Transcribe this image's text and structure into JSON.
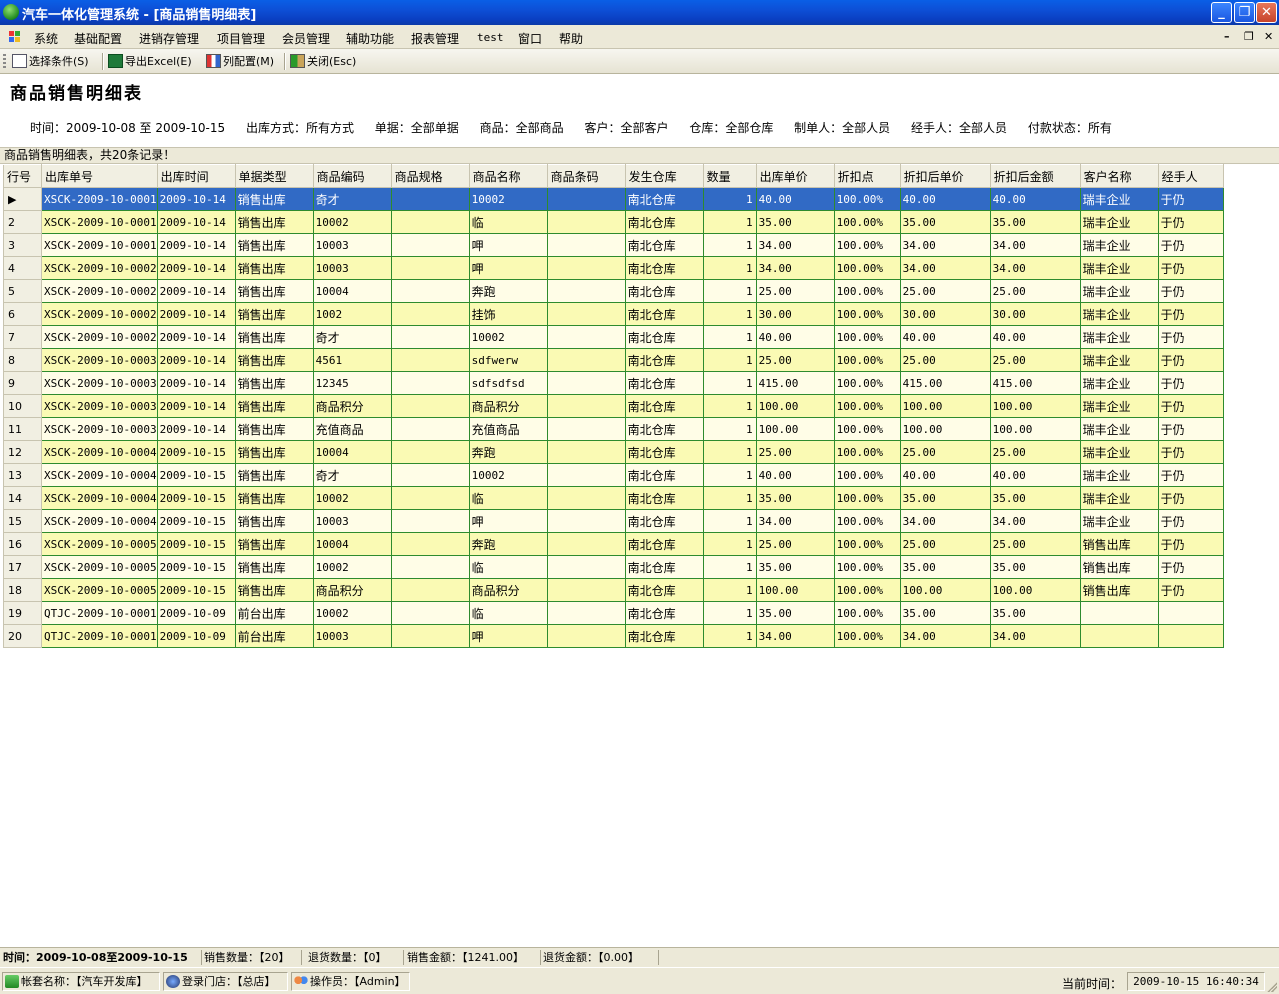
{
  "window": {
    "title": "汽车一体化管理系统 - [商品销售明细表]",
    "minimize": "_",
    "restore": "❐",
    "close": "✕"
  },
  "menu": {
    "items": [
      "系统",
      "基础配置",
      "进销存管理",
      "项目管理",
      "会员管理",
      "辅助功能",
      "报表管理",
      "test",
      "窗口",
      "帮助"
    ],
    "mdi_minimize": "–",
    "mdi_restore": "❐",
    "mdi_close": "✕"
  },
  "toolbar": {
    "select_condition": "选择条件(S)",
    "export_excel": "导出Excel(E)",
    "column_config": "列配置(M)",
    "close": "关闭(Esc)"
  },
  "report": {
    "title": "商品销售明细表",
    "filters": {
      "time": "时间：2009-10-08 至 2009-10-15",
      "out_method": "出库方式：所有方式",
      "doc": "单据：全部单据",
      "product": "商品：全部商品",
      "customer": "客户：全部客户",
      "warehouse": "仓库：全部仓库",
      "creator": "制单人：全部人员",
      "handler": "经手人：全部人员",
      "pay_status": "付款状态：所有"
    },
    "summary": "商品销售明细表，共20条记录！"
  },
  "grid": {
    "headers": [
      "行号",
      "出库单号",
      "出库时间",
      "单据类型",
      "商品编码",
      "商品规格",
      "商品名称",
      "商品条码",
      "发生仓库",
      "数量",
      "出库单价",
      "折扣点",
      "折扣后单价",
      "折扣后金额",
      "客户名称",
      "经手人"
    ],
    "selected_row": 0,
    "rows": [
      [
        "▶",
        "XSCK-2009-10-0001",
        "2009-10-14",
        "销售出库",
        "奇才",
        "",
        "10002",
        "",
        "南北仓库",
        "1",
        "40.00",
        "100.00%",
        "40.00",
        "40.00",
        "瑞丰企业",
        "于仍"
      ],
      [
        "2",
        "XSCK-2009-10-0001",
        "2009-10-14",
        "销售出库",
        "10002",
        "",
        "临",
        "",
        "南北仓库",
        "1",
        "35.00",
        "100.00%",
        "35.00",
        "35.00",
        "瑞丰企业",
        "于仍"
      ],
      [
        "3",
        "XSCK-2009-10-0001",
        "2009-10-14",
        "销售出库",
        "10003",
        "",
        "呷",
        "",
        "南北仓库",
        "1",
        "34.00",
        "100.00%",
        "34.00",
        "34.00",
        "瑞丰企业",
        "于仍"
      ],
      [
        "4",
        "XSCK-2009-10-0002",
        "2009-10-14",
        "销售出库",
        "10003",
        "",
        "呷",
        "",
        "南北仓库",
        "1",
        "34.00",
        "100.00%",
        "34.00",
        "34.00",
        "瑞丰企业",
        "于仍"
      ],
      [
        "5",
        "XSCK-2009-10-0002",
        "2009-10-14",
        "销售出库",
        "10004",
        "",
        "奔跑",
        "",
        "南北仓库",
        "1",
        "25.00",
        "100.00%",
        "25.00",
        "25.00",
        "瑞丰企业",
        "于仍"
      ],
      [
        "6",
        "XSCK-2009-10-0002",
        "2009-10-14",
        "销售出库",
        "1002",
        "",
        "挂饰",
        "",
        "南北仓库",
        "1",
        "30.00",
        "100.00%",
        "30.00",
        "30.00",
        "瑞丰企业",
        "于仍"
      ],
      [
        "7",
        "XSCK-2009-10-0002",
        "2009-10-14",
        "销售出库",
        "奇才",
        "",
        "10002",
        "",
        "南北仓库",
        "1",
        "40.00",
        "100.00%",
        "40.00",
        "40.00",
        "瑞丰企业",
        "于仍"
      ],
      [
        "8",
        "XSCK-2009-10-0003",
        "2009-10-14",
        "销售出库",
        "4561",
        "",
        "sdfwerw",
        "",
        "南北仓库",
        "1",
        "25.00",
        "100.00%",
        "25.00",
        "25.00",
        "瑞丰企业",
        "于仍"
      ],
      [
        "9",
        "XSCK-2009-10-0003",
        "2009-10-14",
        "销售出库",
        "12345",
        "",
        "sdfsdfsd",
        "",
        "南北仓库",
        "1",
        "415.00",
        "100.00%",
        "415.00",
        "415.00",
        "瑞丰企业",
        "于仍"
      ],
      [
        "10",
        "XSCK-2009-10-0003",
        "2009-10-14",
        "销售出库",
        "商品积分",
        "",
        "商品积分",
        "",
        "南北仓库",
        "1",
        "100.00",
        "100.00%",
        "100.00",
        "100.00",
        "瑞丰企业",
        "于仍"
      ],
      [
        "11",
        "XSCK-2009-10-0003",
        "2009-10-14",
        "销售出库",
        "充值商品",
        "",
        "充值商品",
        "",
        "南北仓库",
        "1",
        "100.00",
        "100.00%",
        "100.00",
        "100.00",
        "瑞丰企业",
        "于仍"
      ],
      [
        "12",
        "XSCK-2009-10-0004",
        "2009-10-15",
        "销售出库",
        "10004",
        "",
        "奔跑",
        "",
        "南北仓库",
        "1",
        "25.00",
        "100.00%",
        "25.00",
        "25.00",
        "瑞丰企业",
        "于仍"
      ],
      [
        "13",
        "XSCK-2009-10-0004",
        "2009-10-15",
        "销售出库",
        "奇才",
        "",
        "10002",
        "",
        "南北仓库",
        "1",
        "40.00",
        "100.00%",
        "40.00",
        "40.00",
        "瑞丰企业",
        "于仍"
      ],
      [
        "14",
        "XSCK-2009-10-0004",
        "2009-10-15",
        "销售出库",
        "10002",
        "",
        "临",
        "",
        "南北仓库",
        "1",
        "35.00",
        "100.00%",
        "35.00",
        "35.00",
        "瑞丰企业",
        "于仍"
      ],
      [
        "15",
        "XSCK-2009-10-0004",
        "2009-10-15",
        "销售出库",
        "10003",
        "",
        "呷",
        "",
        "南北仓库",
        "1",
        "34.00",
        "100.00%",
        "34.00",
        "34.00",
        "瑞丰企业",
        "于仍"
      ],
      [
        "16",
        "XSCK-2009-10-0005",
        "2009-10-15",
        "销售出库",
        "10004",
        "",
        "奔跑",
        "",
        "南北仓库",
        "1",
        "25.00",
        "100.00%",
        "25.00",
        "25.00",
        "销售出库",
        "于仍"
      ],
      [
        "17",
        "XSCK-2009-10-0005",
        "2009-10-15",
        "销售出库",
        "10002",
        "",
        "临",
        "",
        "南北仓库",
        "1",
        "35.00",
        "100.00%",
        "35.00",
        "35.00",
        "销售出库",
        "于仍"
      ],
      [
        "18",
        "XSCK-2009-10-0005",
        "2009-10-15",
        "销售出库",
        "商品积分",
        "",
        "商品积分",
        "",
        "南北仓库",
        "1",
        "100.00",
        "100.00%",
        "100.00",
        "100.00",
        "销售出库",
        "于仍"
      ],
      [
        "19",
        "QTJC-2009-10-0001",
        "2009-10-09",
        "前台出库",
        "10002",
        "",
        "临",
        "",
        "南北仓库",
        "1",
        "35.00",
        "100.00%",
        "35.00",
        "35.00",
        "",
        ""
      ],
      [
        "20",
        "QTJC-2009-10-0001",
        "2009-10-09",
        "前台出库",
        "10003",
        "",
        "呷",
        "",
        "南北仓库",
        "1",
        "34.00",
        "100.00%",
        "34.00",
        "34.00",
        "",
        ""
      ]
    ]
  },
  "footer": {
    "time": "时间：2009-10-08至2009-10-15",
    "sales_qty": "销售数量：【20】",
    "return_qty": "退货数量：【0】",
    "sales_amount": "销售金额：【1241.00】",
    "return_amount": "退货金额：【0.00】"
  },
  "statusbar": {
    "account": "帐套名称：【汽车开发库】",
    "store": "登录门店：【总店】",
    "operator": "操作员：【Admin】",
    "time_label": "当前时间：",
    "time_value": "2009-10-15 16:40:34"
  },
  "colors": {
    "title_bar": "#0a4fd6",
    "selected_row": "#316ac5",
    "row_odd": "#fffde7",
    "row_even": "#fafab4",
    "grid_line": "#2e8b2e",
    "chrome": "#ece9d8"
  }
}
